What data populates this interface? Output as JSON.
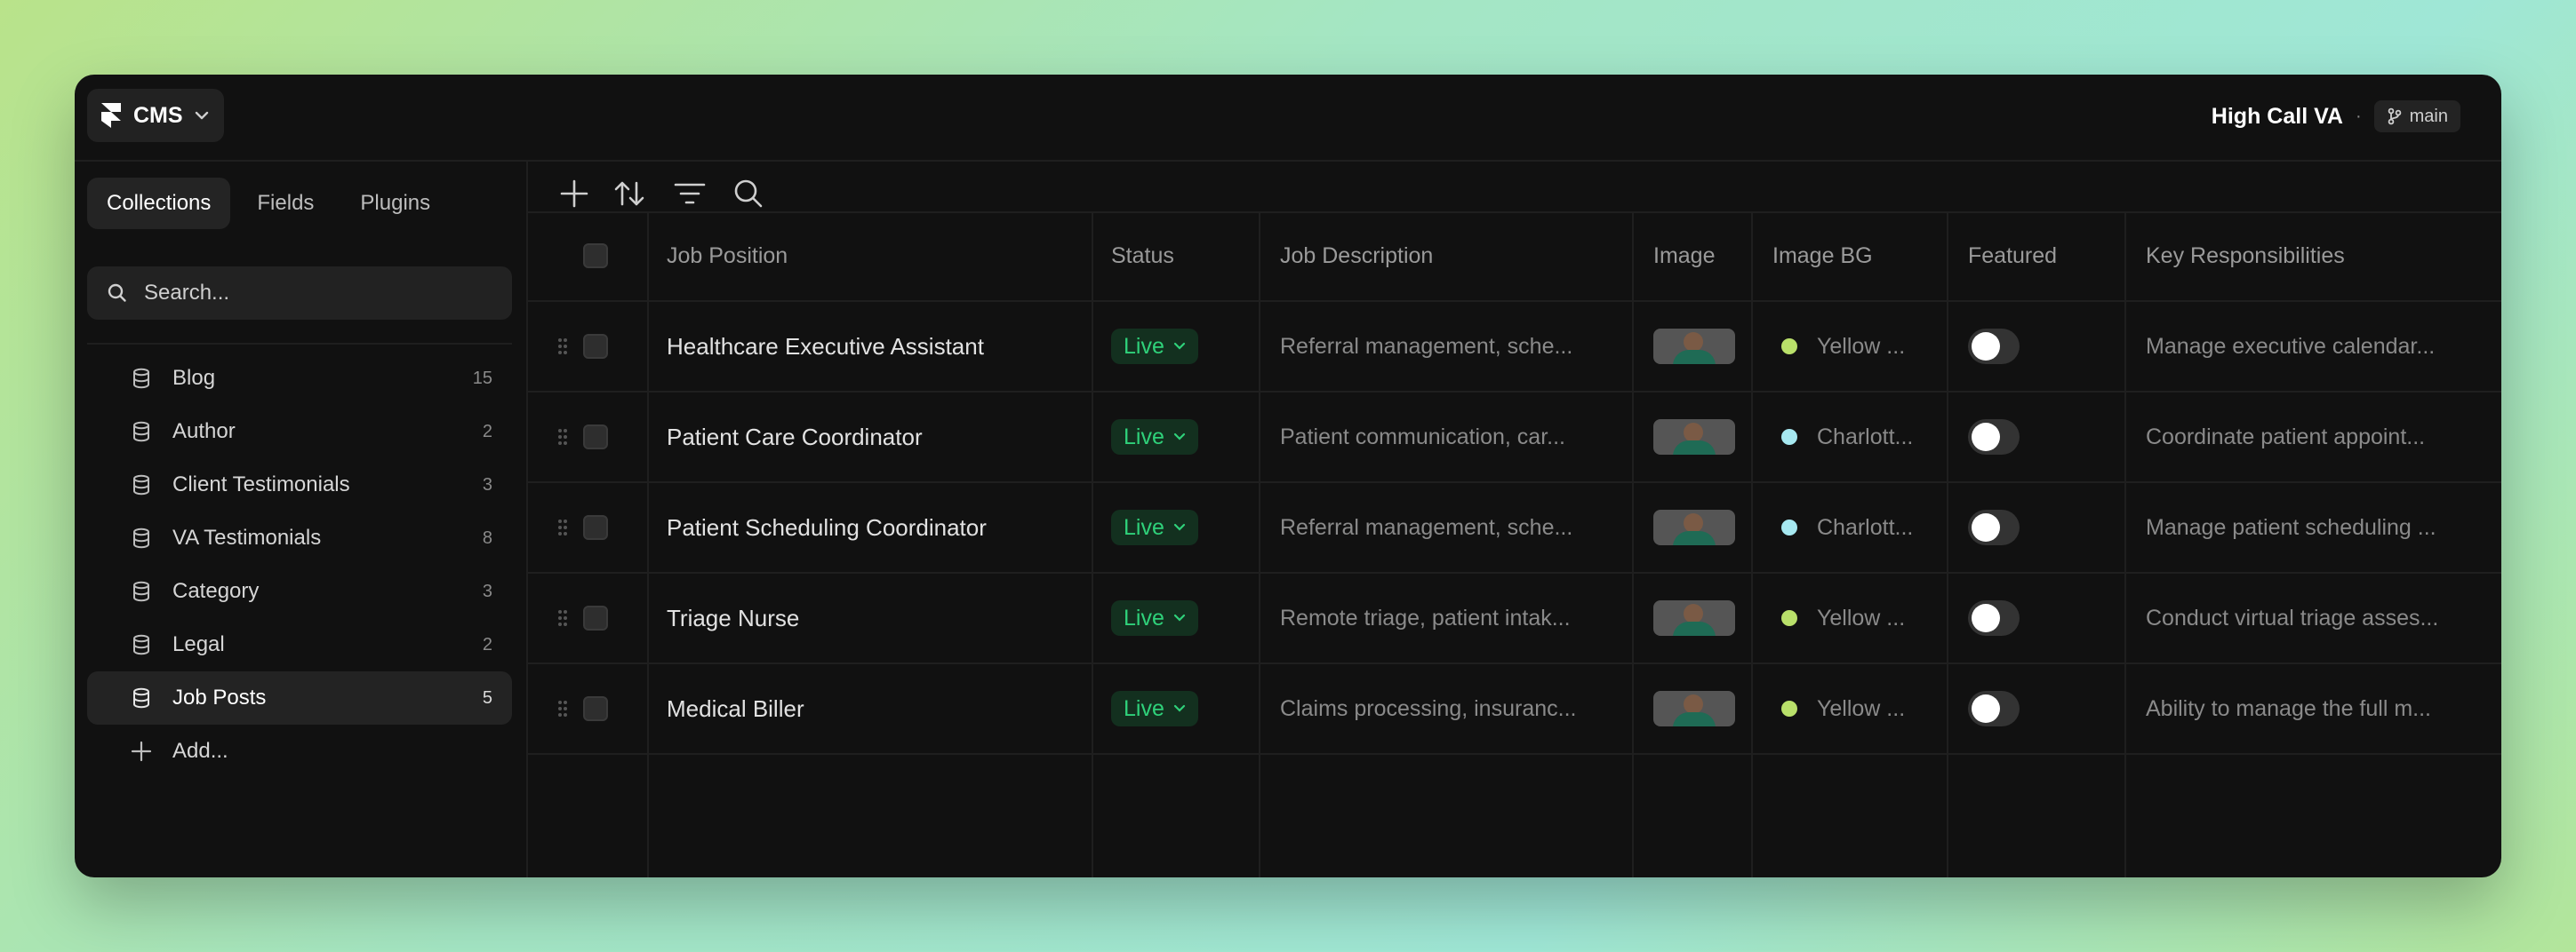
{
  "header": {
    "app_label": "CMS",
    "project_name": "High Call VA",
    "separator": "·",
    "branch": "main"
  },
  "sidebar": {
    "tabs": [
      {
        "label": "Collections",
        "active": true
      },
      {
        "label": "Fields",
        "active": false
      },
      {
        "label": "Plugins",
        "active": false
      }
    ],
    "search_placeholder": "Search...",
    "collections": [
      {
        "name": "Blog",
        "count": "15",
        "active": false
      },
      {
        "name": "Author",
        "count": "2",
        "active": false
      },
      {
        "name": "Client Testimonials",
        "count": "3",
        "active": false
      },
      {
        "name": "VA Testimonials",
        "count": "8",
        "active": false
      },
      {
        "name": "Category",
        "count": "3",
        "active": false
      },
      {
        "name": "Legal",
        "count": "2",
        "active": false
      },
      {
        "name": "Job Posts",
        "count": "5",
        "active": true
      }
    ],
    "add_label": "Add..."
  },
  "toolbar": {
    "icons": [
      "plus-icon",
      "sort-icon",
      "filter-icon",
      "search-icon"
    ]
  },
  "table": {
    "columns": [
      "Job Position",
      "Status",
      "Job Description",
      "Image",
      "Image BG",
      "Featured",
      "Key Responsibilities"
    ],
    "rows": [
      {
        "position": "Healthcare Executive Assistant",
        "status": "Live",
        "description": "Referral management, sche...",
        "image_bg": "Yellow ...",
        "bg_color": "#b9e06a",
        "featured": false,
        "responsibilities": "Manage executive calendar..."
      },
      {
        "position": "Patient Care Coordinator",
        "status": "Live",
        "description": "Patient communication, car...",
        "image_bg": "Charlott...",
        "bg_color": "#a6e8f0",
        "featured": false,
        "responsibilities": "Coordinate patient appoint..."
      },
      {
        "position": "Patient Scheduling Coordinator",
        "status": "Live",
        "description": "Referral management, sche...",
        "image_bg": "Charlott...",
        "bg_color": "#a6e8f0",
        "featured": false,
        "responsibilities": "Manage patient scheduling ..."
      },
      {
        "position": "Triage Nurse",
        "status": "Live",
        "description": "Remote triage, patient intak...",
        "image_bg": "Yellow ...",
        "bg_color": "#b9e06a",
        "featured": false,
        "responsibilities": "Conduct virtual triage asses..."
      },
      {
        "position": "Medical Biller",
        "status": "Live",
        "description": "Claims processing, insuranc...",
        "image_bg": "Yellow ...",
        "bg_color": "#b9e06a",
        "featured": false,
        "responsibilities": "Ability to manage the full m..."
      }
    ]
  },
  "colors": {
    "status_live": "#2fd17a",
    "window_bg": "#111111"
  }
}
